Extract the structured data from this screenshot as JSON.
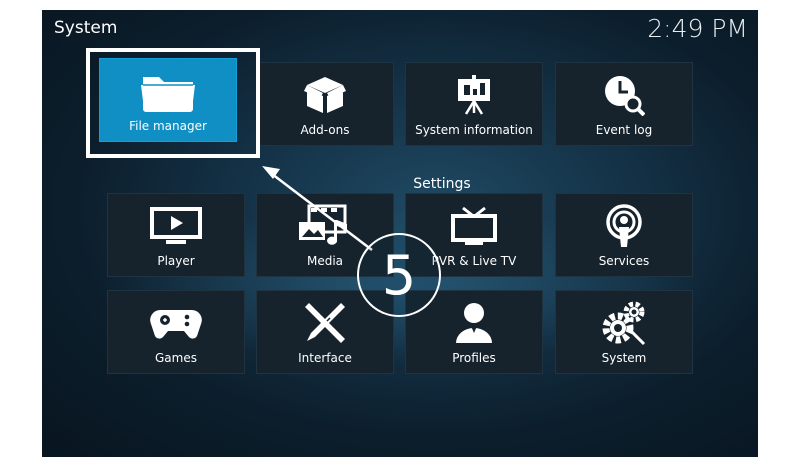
{
  "header": {
    "title": "System",
    "clock": "2:49 PM"
  },
  "top_row": [
    {
      "label": "File manager",
      "icon": "folder-icon",
      "focused": true
    },
    {
      "label": "Add-ons",
      "icon": "box-icon"
    },
    {
      "label": "System information",
      "icon": "presentation-board-icon"
    },
    {
      "label": "Event log",
      "icon": "clock-search-icon"
    }
  ],
  "settings_label": "Settings",
  "settings_rows": [
    [
      {
        "label": "Player",
        "icon": "monitor-play-icon"
      },
      {
        "label": "Media",
        "icon": "media-icon"
      },
      {
        "label": "PVR & Live TV",
        "icon": "tv-icon"
      },
      {
        "label": "Services",
        "icon": "podcast-icon"
      }
    ],
    [
      {
        "label": "Games",
        "icon": "gamepad-icon"
      },
      {
        "label": "Interface",
        "icon": "pencil-ruler-icon"
      },
      {
        "label": "Profiles",
        "icon": "user-icon"
      },
      {
        "label": "System",
        "icon": "gears-icon"
      }
    ]
  ],
  "annotation": {
    "step": "5"
  },
  "colors": {
    "focused_tile": "#0f8fc4",
    "tile": "#16232d",
    "background": "#0c1e2c"
  }
}
